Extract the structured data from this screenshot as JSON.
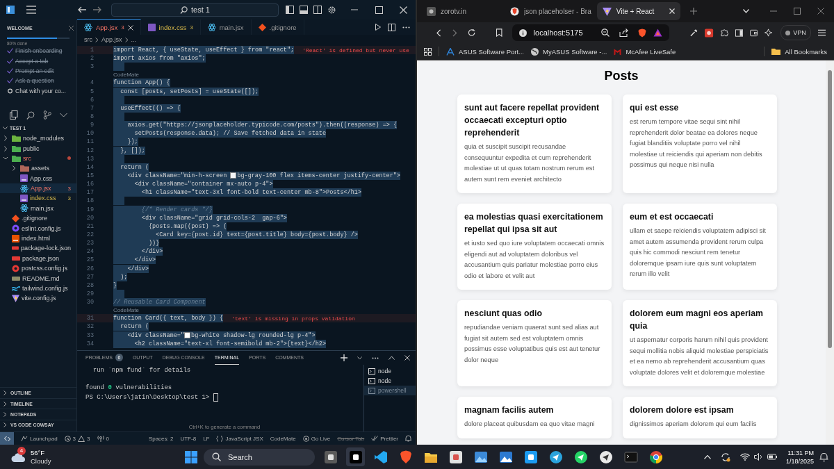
{
  "editor": {
    "search": "test 1",
    "welcome": {
      "title": "WELCOME",
      "level": 0.8,
      "progress_label": "80% done",
      "tasks": [
        {
          "label": "Finish onboarding",
          "checked": true
        },
        {
          "label": "Accept a tab",
          "checked": true
        },
        {
          "label": "Prompt an edit",
          "checked": true
        },
        {
          "label": "Ask a question",
          "checked": true
        },
        {
          "label": "Chat with your co...",
          "checked": false
        }
      ]
    },
    "explorer": {
      "title": "TEST 1",
      "items": [
        {
          "label": "node_modules",
          "kind": "folder",
          "color": "#6cb33f",
          "expanded": false,
          "selected": false,
          "error": false,
          "warning": false
        },
        {
          "label": "public",
          "kind": "folder",
          "color": "#4caf50",
          "expanded": false,
          "selected": false,
          "error": false,
          "warning": false
        },
        {
          "label": "src",
          "kind": "folder",
          "color": "#4caf50",
          "expanded": true,
          "selected": false,
          "error": true,
          "warning": false,
          "children": [
            {
              "label": "assets",
              "kind": "folder",
              "color": "#b0675a",
              "expanded": false,
              "selected": false,
              "error": false,
              "warning": false
            },
            {
              "label": "App.css",
              "kind": "css",
              "selected": false,
              "error": false,
              "warning": false
            },
            {
              "label": "App.jsx",
              "kind": "react",
              "selected": true,
              "error": true,
              "warning": false,
              "badge": "3"
            },
            {
              "label": "index.css",
              "kind": "css",
              "selected": false,
              "error": false,
              "warning": true,
              "badge": "3"
            },
            {
              "label": "main.jsx",
              "kind": "react",
              "selected": false,
              "error": false,
              "warning": false
            }
          ]
        },
        {
          "label": ".gitignore",
          "kind": "git",
          "selected": false,
          "error": false,
          "warning": false
        },
        {
          "label": "eslint.config.js",
          "kind": "eslint",
          "selected": false,
          "error": false,
          "warning": false
        },
        {
          "label": "index.html",
          "kind": "html",
          "selected": false,
          "error": false,
          "warning": false
        },
        {
          "label": "package-lock.json",
          "kind": "json",
          "selected": false,
          "error": false,
          "warning": false
        },
        {
          "label": "package.json",
          "kind": "json",
          "selected": false,
          "error": false,
          "warning": false
        },
        {
          "label": "postcss.config.js",
          "kind": "postcss",
          "selected": false,
          "error": false,
          "warning": false
        },
        {
          "label": "README.md",
          "kind": "md",
          "selected": false,
          "error": false,
          "warning": false
        },
        {
          "label": "tailwind.config.js",
          "kind": "tailwind",
          "selected": false,
          "error": false,
          "warning": false
        },
        {
          "label": "vite.config.js",
          "kind": "vite",
          "selected": false,
          "error": false,
          "warning": false
        }
      ]
    },
    "collapsed_sections": [
      "OUTLINE",
      "TIMELINE",
      "NOTEPADS",
      "VS CODE COWSAY"
    ],
    "tabs": [
      {
        "label": "App.jsx",
        "kind": "react",
        "badge": "3",
        "error": true,
        "warning": false,
        "selected": true
      },
      {
        "label": "index.css",
        "kind": "css",
        "badge": "3",
        "error": false,
        "warning": true,
        "selected": false
      },
      {
        "label": "main.jsx",
        "kind": "react",
        "error": false,
        "warning": false,
        "selected": false
      },
      {
        "label": ".gitignore",
        "kind": "git",
        "error": false,
        "warning": false,
        "selected": false
      }
    ],
    "breadcrumb": [
      "src",
      "App.jsx",
      "..."
    ],
    "code_lines": [
      {
        "kind": "code",
        "number": "1",
        "text": "import React, { useState, useEffect } from \"react\";",
        "diagnostic": "'React' is defined but never use"
      },
      {
        "kind": "code",
        "number": "2",
        "text": "import axios from \"axios\";"
      },
      {
        "kind": "code",
        "number": "3"
      },
      {
        "kind": "lens",
        "text": "CodeMate"
      },
      {
        "kind": "code",
        "number": "4",
        "text": "function App() {"
      },
      {
        "kind": "code",
        "number": "5",
        "text": "  const [posts, setPosts] = useState([]);"
      },
      {
        "kind": "code",
        "number": "6"
      },
      {
        "kind": "code",
        "number": "7",
        "text": "  useEffect(() => {"
      },
      {
        "kind": "code",
        "number": "8"
      },
      {
        "kind": "code",
        "number": "9",
        "text": "    axios.get(\"https://jsonplaceholder.typicode.com/posts\").then((response) => {"
      },
      {
        "kind": "code",
        "number": "10",
        "text": "      setPosts(response.data); // Save fetched data in state"
      },
      {
        "kind": "code",
        "number": "11",
        "text": "    });"
      },
      {
        "kind": "code",
        "number": "12",
        "text": "  }, []);"
      },
      {
        "kind": "code",
        "number": "13"
      },
      {
        "kind": "code",
        "number": "14",
        "text": "  return ("
      },
      {
        "kind": "code",
        "number": "15",
        "text": "    <div className=\"min-h-screen ",
        "color": "#f3f4f6",
        "rest": "bg-gray-100 flex items-center justify-center\">"
      },
      {
        "kind": "code",
        "number": "16",
        "text": "      <div className=\"container mx-auto p-4\">"
      },
      {
        "kind": "code",
        "number": "17",
        "text": "        <h1 className=\"text-3xl font-bold text-center mb-8\">Posts</h1>"
      },
      {
        "kind": "code",
        "number": "18"
      },
      {
        "kind": "comment",
        "number": "19",
        "text": "        {/* Render cards */}"
      },
      {
        "kind": "code",
        "number": "20",
        "text": "        <div className=\"grid grid-cols-2  gap-6\">"
      },
      {
        "kind": "code",
        "number": "21",
        "text": "          {posts.map((post) => ("
      },
      {
        "kind": "code",
        "number": "22",
        "text": "            <Card key={post.id} text={post.title} body={post.body} />"
      },
      {
        "kind": "code",
        "number": "23",
        "text": "          ))}"
      },
      {
        "kind": "code",
        "number": "24",
        "text": "        </div>"
      },
      {
        "kind": "code",
        "number": "25",
        "text": "      </div>"
      },
      {
        "kind": "code",
        "number": "26",
        "text": "    </div>"
      },
      {
        "kind": "code",
        "number": "27",
        "text": "  );"
      },
      {
        "kind": "code",
        "number": "28",
        "text": "}"
      },
      {
        "kind": "code",
        "number": "29"
      },
      {
        "kind": "comment",
        "number": "30",
        "text": "// Reusable Card Component"
      },
      {
        "kind": "lens",
        "text": "CodeMate"
      },
      {
        "kind": "code",
        "number": "31",
        "text": "function Card({ text, body }) {",
        "diagnostic": "'text' is missing in props validation"
      },
      {
        "kind": "code",
        "number": "32",
        "text": "  return ("
      },
      {
        "kind": "code",
        "number": "33",
        "text": "    <div className=\"",
        "color": "#ffffff",
        "rest": "bg-white shadow-lg rounded-lg p-4\">"
      },
      {
        "kind": "code",
        "number": "34",
        "text": "      <h2 className=\"text-xl font-semibold mb-2\">{text}</h2>"
      }
    ],
    "panel": {
      "tabs": [
        {
          "label": "PROBLEMS",
          "badge": "6",
          "selected": false
        },
        {
          "label": "OUTPUT",
          "selected": false
        },
        {
          "label": "DEBUG CONSOLE",
          "selected": false
        },
        {
          "label": "TERMINAL",
          "selected": true
        },
        {
          "label": "PORTS",
          "selected": false
        },
        {
          "label": "COMMENTS",
          "selected": false
        }
      ],
      "terminal_lines": [
        {
          "segments": [
            {
              "text": "  run `npm fund` for details",
              "kind": "plain"
            }
          ]
        },
        {
          "segments": [
            {
              "text": "found ",
              "kind": "plain"
            },
            {
              "text": "0",
              "kind": "success"
            },
            {
              "text": " vulnerabilities",
              "kind": "plain"
            }
          ]
        }
      ],
      "prompt": "PS C:\\Users\\jatin\\Desktop\\test 1> ",
      "hint": "Ctrl+K to generate a command",
      "terminals": [
        {
          "label": "node",
          "selected": false
        },
        {
          "label": "node",
          "selected": false
        },
        {
          "label": "powershell",
          "selected": true
        }
      ]
    },
    "status_left": [
      {
        "kind": "remote"
      },
      {
        "kind": "launchpad",
        "text": "Launchpad"
      },
      {
        "kind": "errors",
        "text": "3"
      },
      {
        "kind": "warnings",
        "text": "3"
      },
      {
        "kind": "ports",
        "text": "0"
      }
    ],
    "status_right": [
      {
        "kind": "text",
        "text": "Spaces: 2",
        "disabled": false
      },
      {
        "kind": "text",
        "text": "UTF-8",
        "disabled": false
      },
      {
        "kind": "text",
        "text": "LF",
        "disabled": false
      },
      {
        "kind": "language",
        "text": "JavaScript JSX",
        "disabled": false
      },
      {
        "kind": "text",
        "text": "CodeMate",
        "disabled": false
      },
      {
        "kind": "live",
        "text": "Go Live",
        "disabled": false
      },
      {
        "kind": "text",
        "text": "Cursor Tab",
        "disabled": true
      },
      {
        "kind": "prettier",
        "text": "Prettier",
        "disabled": false
      },
      {
        "kind": "bell"
      }
    ]
  },
  "browser": {
    "tabs": [
      {
        "label": "zorotv.in",
        "kind": "site",
        "selected": false
      },
      {
        "label": "json placeholser - Bra",
        "kind": "brave",
        "selected": false
      },
      {
        "label": "Vite + React",
        "kind": "vite",
        "selected": true
      }
    ],
    "address": "localhost:5175",
    "vpn": "VPN",
    "bookmarks": [
      {
        "label": "ASUS Software Port...",
        "kind": "asus"
      },
      {
        "label": "MyASUS Software -...",
        "kind": "globe"
      },
      {
        "label": "McAfee LiveSafe",
        "kind": "mcafee"
      }
    ],
    "all_bookmarks": "All Bookmarks",
    "page": {
      "heading": "Posts",
      "posts": [
        {
          "title": "sunt aut facere repellat provident occaecati excepturi optio reprehenderit",
          "body": "quia et suscipit suscipit recusandae consequuntur expedita et cum reprehenderit molestiae ut ut quas totam nostrum rerum est autem sunt rem eveniet architecto"
        },
        {
          "title": "qui est esse",
          "body": "est rerum tempore vitae sequi sint nihil reprehenderit dolor beatae ea dolores neque fugiat blanditiis voluptate porro vel nihil molestiae ut reiciendis qui aperiam non debitis possimus qui neque nisi nulla"
        },
        {
          "title": "ea molestias quasi exercitationem repellat qui ipsa sit aut",
          "body": "et iusto sed quo iure voluptatem occaecati omnis eligendi aut ad voluptatem doloribus vel accusantium quis pariatur molestiae porro eius odio et labore et velit aut"
        },
        {
          "title": "eum et est occaecati",
          "body": "ullam et saepe reiciendis voluptatem adipisci sit amet autem assumenda provident rerum culpa quis hic commodi nesciunt rem tenetur doloremque ipsam iure quis sunt voluptatem rerum illo velit"
        },
        {
          "title": "nesciunt quas odio",
          "body": "repudiandae veniam quaerat sunt sed alias aut fugiat sit autem sed est voluptatem omnis possimus esse voluptatibus quis est aut tenetur dolor neque"
        },
        {
          "title": "dolorem eum magni eos aperiam quia",
          "body": "ut aspernatur corporis harum nihil quis provident sequi mollitia nobis aliquid molestiae perspiciatis et ea nemo ab reprehenderit accusantium quas voluptate dolores velit et doloremque molestiae"
        },
        {
          "title": "magnam facilis autem",
          "body": "dolore placeat quibusdam ea quo vitae magni"
        },
        {
          "title": "dolorem dolore est ipsam",
          "body": "dignissimos aperiam dolorem qui eum facilis"
        }
      ]
    }
  },
  "taskbar": {
    "weather": {
      "badge": "4",
      "temperature": "56°F",
      "condition": "Cloudy"
    },
    "search": "Search",
    "apps": [
      {
        "kind": "taskview"
      },
      {
        "kind": "capture"
      },
      {
        "kind": "vscode"
      },
      {
        "kind": "brave"
      },
      {
        "kind": "folder"
      },
      {
        "kind": "notes"
      },
      {
        "kind": "photos"
      },
      {
        "kind": "gallery"
      },
      {
        "kind": "twitter"
      },
      {
        "kind": "telegram"
      },
      {
        "kind": "whatsapp"
      },
      {
        "kind": "chatgpt"
      },
      {
        "kind": "terminal"
      },
      {
        "kind": "chrome"
      }
    ],
    "time": "11:31 PM",
    "date": "1/18/2025"
  }
}
